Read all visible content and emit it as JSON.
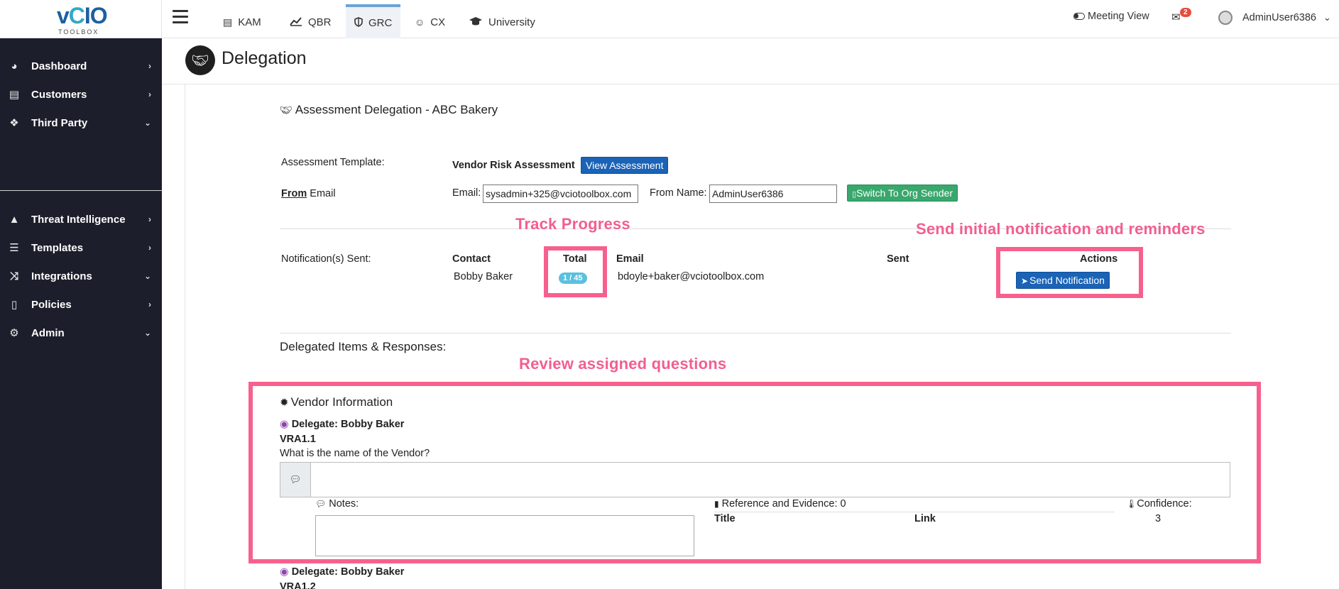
{
  "brand": {
    "logo_text": "vCIO",
    "logo_sub": "TOOLBOX"
  },
  "nav_tabs": [
    {
      "label": "KAM",
      "icon": "id-card-icon"
    },
    {
      "label": "QBR",
      "icon": "line-chart-icon"
    },
    {
      "label": "GRC",
      "icon": "shield-icon",
      "active": true
    },
    {
      "label": "CX",
      "icon": "smile-icon"
    },
    {
      "label": "University",
      "icon": "graduation-cap-icon"
    }
  ],
  "topbar_right": {
    "meeting_view": "Meeting View",
    "mail_count": "2",
    "user": "AdminUser6386"
  },
  "sidebar": {
    "items": [
      {
        "label": "Dashboard",
        "icon": "dashboard-icon",
        "chevron": "›"
      },
      {
        "label": "Customers",
        "icon": "address-card-icon",
        "chevron": "›"
      },
      {
        "label": "Third Party",
        "icon": "cubes-icon",
        "chevron": "⌄"
      },
      {
        "label": "Threat Intelligence",
        "icon": "warning-icon",
        "chevron": "›"
      },
      {
        "label": "Templates",
        "icon": "list-icon",
        "chevron": "›"
      },
      {
        "label": "Integrations",
        "icon": "shuffle-icon",
        "chevron": "⌄"
      },
      {
        "label": "Policies",
        "icon": "file-icon",
        "chevron": "›"
      },
      {
        "label": "Admin",
        "icon": "cogs-icon",
        "chevron": "⌄"
      }
    ]
  },
  "page": {
    "title": "Delegation"
  },
  "assessment": {
    "heading": "Assessment Delegation - ABC Bakery",
    "template_label": "Assessment Template:",
    "template_name": "Vendor Risk Assessment",
    "view_button": "View Assessment",
    "from_label_bold": "From",
    "from_label_rest": "Email",
    "email_label": "Email:",
    "email_value": "sysadmin+325@vciotoolbox.com",
    "from_name_label": "From Name:",
    "from_name_value": "AdminUser6386",
    "switch_button": "Switch To Org Sender",
    "notifications_label": "Notification(s) Sent:",
    "columns": {
      "contact": "Contact",
      "total": "Total",
      "email": "Email",
      "sent": "Sent",
      "actions": "Actions"
    },
    "row": {
      "contact": "Bobby Baker",
      "total": "1 / 45",
      "email": "bdoyle+baker@vciotoolbox.com",
      "sent": "",
      "action": "Send Notification"
    }
  },
  "annotations": {
    "track": "Track Progress",
    "send": "Send initial notification and reminders",
    "review": "Review assigned questions"
  },
  "delegated": {
    "heading": "Delegated Items & Responses:",
    "section": "Vendor Information",
    "items": [
      {
        "delegate": "Delegate: Bobby Baker",
        "code": "VRA1.1",
        "question": "What is the name of the Vendor?",
        "notes_label": "Notes:",
        "reference_label": "Reference and Evidence: 0",
        "title_col": "Title",
        "link_col": "Link",
        "confidence_label": "Confidence:",
        "confidence_value": "3"
      },
      {
        "delegate": "Delegate: Bobby Baker",
        "code": "VRA1.2"
      }
    ]
  }
}
